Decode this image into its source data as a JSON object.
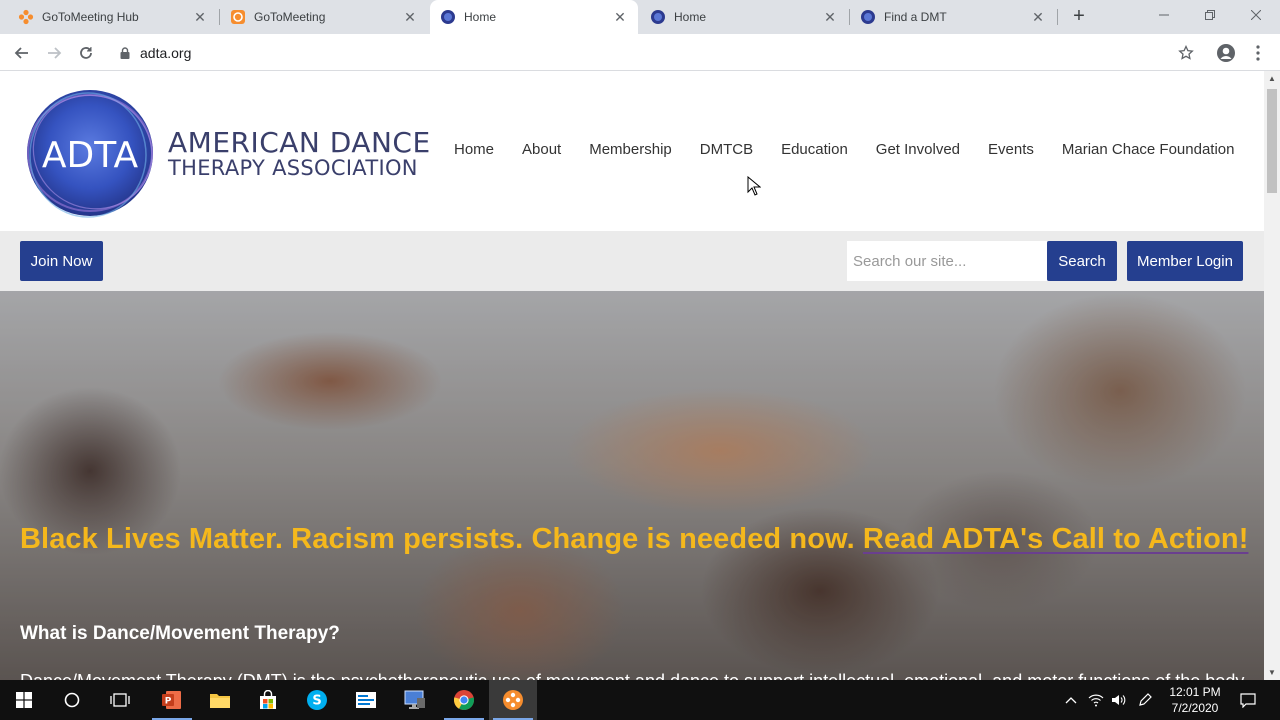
{
  "browser": {
    "tabs": [
      {
        "title": "GoToMeeting Hub",
        "icon": "gotomeeting-hub-icon",
        "active": false
      },
      {
        "title": "GoToMeeting",
        "icon": "gotomeeting-icon",
        "active": false
      },
      {
        "title": "Home",
        "icon": "adta-favicon",
        "active": true
      },
      {
        "title": "Home",
        "icon": "adta-favicon",
        "active": false
      },
      {
        "title": "Find a DMT",
        "icon": "adta-favicon",
        "active": false
      }
    ],
    "new_tab_label": "+",
    "url": "adta.org"
  },
  "site": {
    "logo_abbrev": "ADTA",
    "logo_line1": "AMERICAN DANCE",
    "logo_line2": "THERAPY ASSOCIATION",
    "nav": [
      "Home",
      "About",
      "Membership",
      "DMTCB",
      "Education",
      "Get Involved",
      "Events",
      "Marian Chace Foundation"
    ],
    "join_label": "Join Now",
    "search_placeholder": "Search our site...",
    "search_label": "Search",
    "member_login_label": "Member Login"
  },
  "hero": {
    "banner_text": "Black Lives Matter. Racism persists. Change is needed now. ",
    "banner_link": "Read ADTA's Call to Action!",
    "heading": "What is Dance/Movement Therapy?",
    "paragraph": "Dance/Movement Therapy (DMT) is the psychotherapeutic use of movement and dance to support intellectual, emotional, and motor functions of the body. As a modality of the creative arts therapies, DMT looks at the correlation between movement and emotion."
  },
  "taskbar": {
    "time": "12:01 PM",
    "date": "7/2/2020",
    "apps": [
      "start-icon",
      "cortana-icon",
      "task-view-icon",
      "powerpoint-icon",
      "file-explorer-icon",
      "store-icon",
      "skype-icon",
      "outlook-icon",
      "remote-desktop-icon",
      "chrome-icon",
      "gotomeeting-icon"
    ]
  },
  "colors": {
    "brand_blue": "#253f8f",
    "banner_yellow": "#f5b81c",
    "logo_text": "#3a3f6b"
  }
}
